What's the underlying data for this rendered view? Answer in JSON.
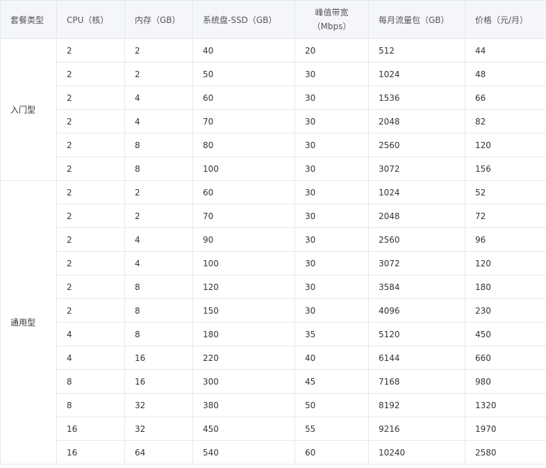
{
  "headers": {
    "type": "套餐类型",
    "cpu": "CPU（核）",
    "mem": "内存（GB）",
    "disk": "系统盘-SSD（GB）",
    "bw_line1": "峰值带宽",
    "bw_line2": "（Mbps）",
    "traffic": "每月流量包（GB）",
    "price": "价格（元/月）"
  },
  "groups": [
    {
      "name": "入门型",
      "rows": [
        [
          "2",
          "2",
          "40",
          "20",
          "512",
          "44"
        ],
        [
          "2",
          "2",
          "50",
          "30",
          "1024",
          "48"
        ],
        [
          "2",
          "4",
          "60",
          "30",
          "1536",
          "66"
        ],
        [
          "2",
          "4",
          "70",
          "30",
          "2048",
          "82"
        ],
        [
          "2",
          "8",
          "80",
          "30",
          "2560",
          "120"
        ],
        [
          "2",
          "8",
          "100",
          "30",
          "3072",
          "156"
        ]
      ]
    },
    {
      "name": "通用型",
      "rows": [
        [
          "2",
          "2",
          "60",
          "30",
          "1024",
          "52"
        ],
        [
          "2",
          "2",
          "70",
          "30",
          "2048",
          "72"
        ],
        [
          "2",
          "4",
          "90",
          "30",
          "2560",
          "96"
        ],
        [
          "2",
          "4",
          "100",
          "30",
          "3072",
          "120"
        ],
        [
          "2",
          "8",
          "120",
          "30",
          "3584",
          "180"
        ],
        [
          "2",
          "8",
          "150",
          "30",
          "4096",
          "230"
        ],
        [
          "4",
          "8",
          "180",
          "35",
          "5120",
          "450"
        ],
        [
          "4",
          "16",
          "220",
          "40",
          "6144",
          "660"
        ],
        [
          "8",
          "16",
          "300",
          "45",
          "7168",
          "980"
        ],
        [
          "8",
          "32",
          "380",
          "50",
          "8192",
          "1320"
        ],
        [
          "16",
          "32",
          "450",
          "55",
          "9216",
          "1970"
        ],
        [
          "16",
          "64",
          "540",
          "60",
          "10240",
          "2580"
        ]
      ]
    }
  ]
}
